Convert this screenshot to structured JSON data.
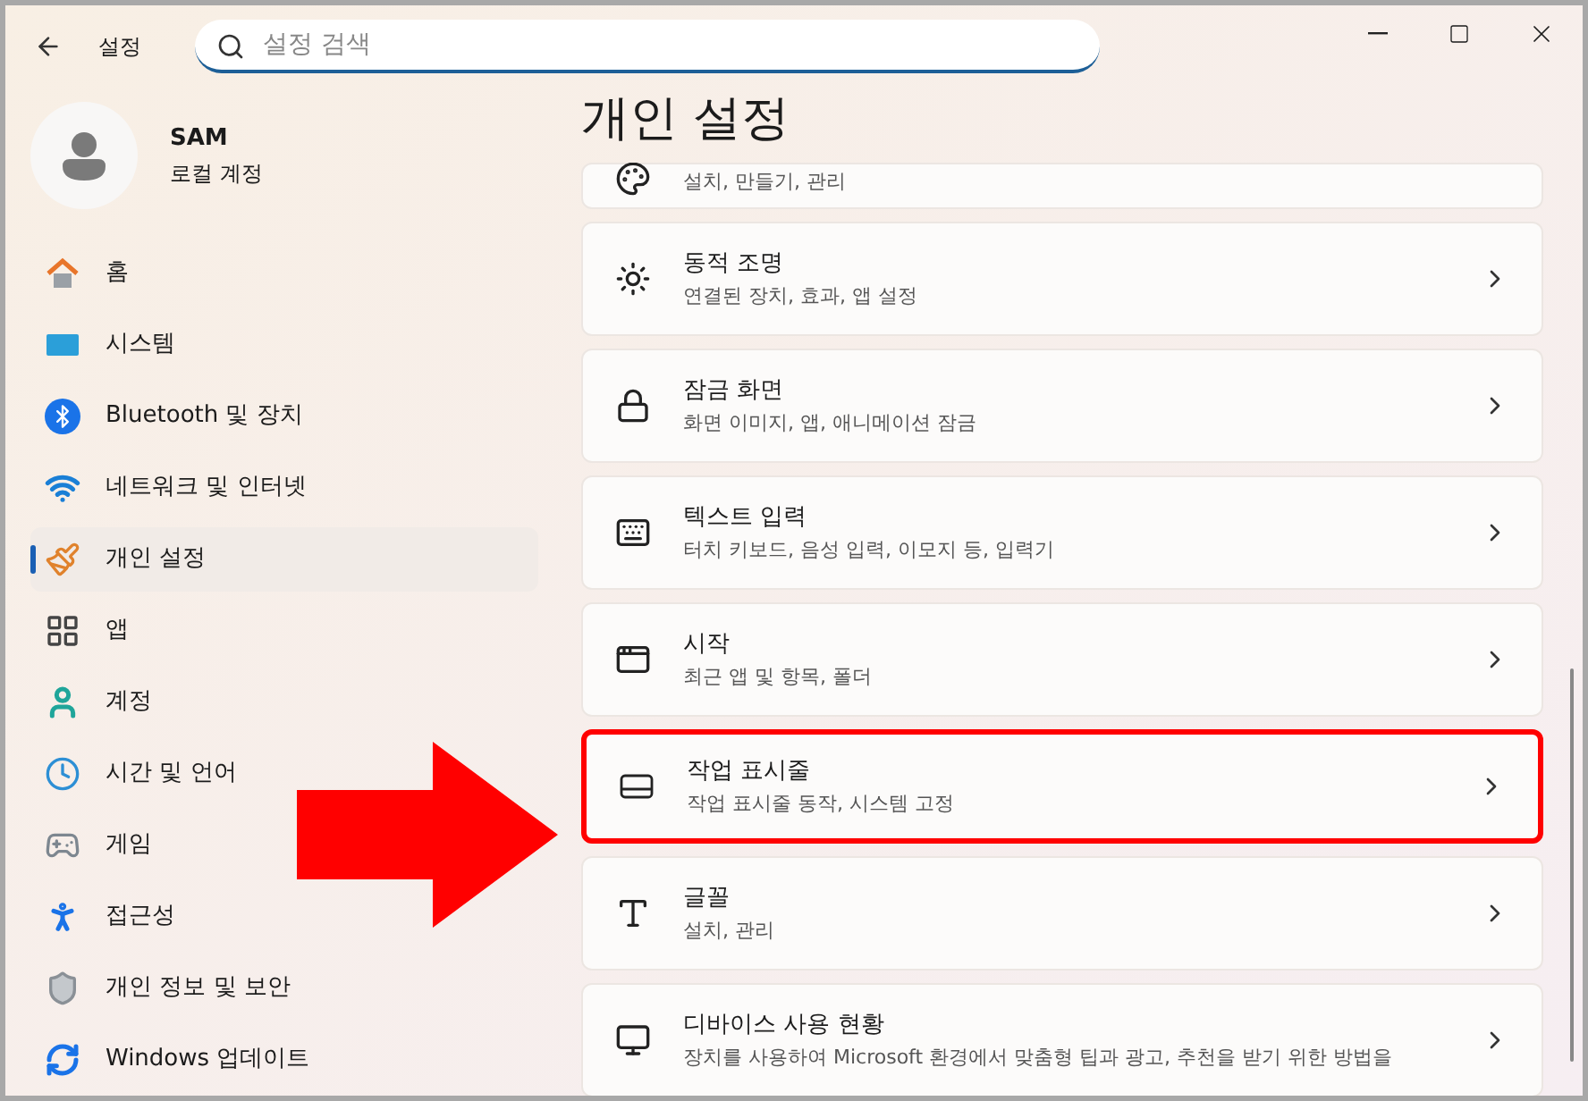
{
  "window": {
    "title": "설정"
  },
  "search": {
    "placeholder": "설정 검색"
  },
  "account": {
    "name": "SAM",
    "type": "로컬 계정"
  },
  "sidebar": {
    "items": [
      {
        "label": "홈",
        "selected": false
      },
      {
        "label": "시스템",
        "selected": false
      },
      {
        "label": "Bluetooth 및 장치",
        "selected": false
      },
      {
        "label": "네트워크 및 인터넷",
        "selected": false
      },
      {
        "label": "개인 설정",
        "selected": true
      },
      {
        "label": "앱",
        "selected": false
      },
      {
        "label": "계정",
        "selected": false
      },
      {
        "label": "시간 및 언어",
        "selected": false
      },
      {
        "label": "게임",
        "selected": false
      },
      {
        "label": "접근성",
        "selected": false
      },
      {
        "label": "개인 정보 및 보안",
        "selected": false
      },
      {
        "label": "Windows 업데이트",
        "selected": false
      }
    ]
  },
  "page": {
    "title": "개인 설정"
  },
  "cards": [
    {
      "description": "설치, 만들기, 관리",
      "highlighted": false
    },
    {
      "title": "동적 조명",
      "description": "연결된 장치, 효과, 앱 설정",
      "highlighted": false
    },
    {
      "title": "잠금 화면",
      "description": "화면 이미지, 앱, 애니메이션 잠금",
      "highlighted": false
    },
    {
      "title": "텍스트 입력",
      "description": "터치 키보드, 음성 입력, 이모지 등, 입력기",
      "highlighted": false
    },
    {
      "title": "시작",
      "description": "최근 앱 및 항목, 폴더",
      "highlighted": false
    },
    {
      "title": "작업 표시줄",
      "description": "작업 표시줄 동작, 시스템 고정",
      "highlighted": true
    },
    {
      "title": "글꼴",
      "description": "설치, 관리",
      "highlighted": false
    },
    {
      "title": "디바이스 사용 현황",
      "description": "장치를 사용하여 Microsoft 환경에서 맞춤형 팁과 광고, 추천을 받기 위한 방법을",
      "highlighted": false
    }
  ],
  "annotation": {
    "kind": "arrow",
    "color": "#ff0000"
  }
}
